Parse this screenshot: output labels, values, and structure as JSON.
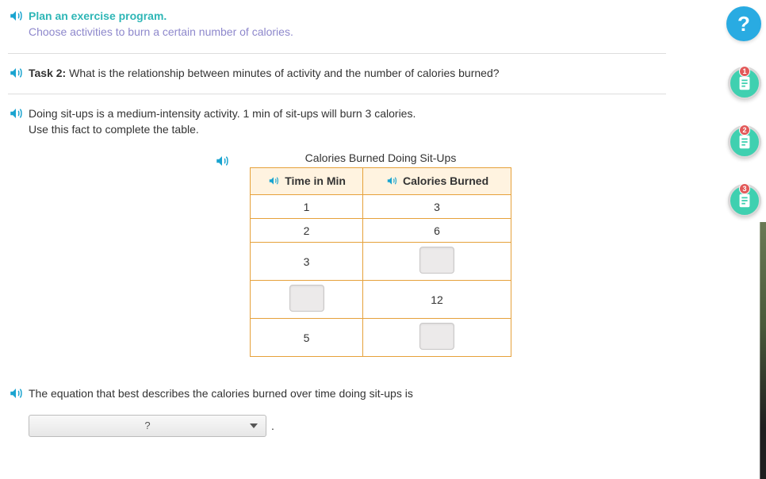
{
  "intro": {
    "title": "Plan an exercise program.",
    "subtitle": "Choose activities to burn a certain number of calories."
  },
  "task": {
    "label": "Task 2:",
    "question": "What is the relationship between minutes of activity and the number of calories burned?"
  },
  "instruction": {
    "line1": "Doing sit-ups is a medium-intensity activity. 1 min of sit-ups will burn 3 calories.",
    "line2": "Use this fact to complete the table."
  },
  "table": {
    "title": "Calories Burned Doing Sit-Ups",
    "col1": "Time in Min",
    "col2": "Calories Burned",
    "rows": [
      {
        "time": "1",
        "cal": "3",
        "time_input": false,
        "cal_input": false
      },
      {
        "time": "2",
        "cal": "6",
        "time_input": false,
        "cal_input": false
      },
      {
        "time": "3",
        "cal": "",
        "time_input": false,
        "cal_input": true
      },
      {
        "time": "",
        "cal": "12",
        "time_input": true,
        "cal_input": false
      },
      {
        "time": "5",
        "cal": "",
        "time_input": false,
        "cal_input": true
      }
    ]
  },
  "equation": {
    "prompt": "The equation that best describes the calories burned over time doing sit-ups is",
    "placeholder": "?",
    "period": "."
  },
  "sidebar": {
    "help": "?",
    "tasks": [
      "1",
      "2",
      "3"
    ]
  },
  "chart_data": {
    "type": "table",
    "title": "Calories Burned Doing Sit-Ups",
    "columns": [
      "Time in Min",
      "Calories Burned"
    ],
    "rows": [
      [
        1,
        3
      ],
      [
        2,
        6
      ],
      [
        3,
        null
      ],
      [
        null,
        12
      ],
      [
        5,
        null
      ]
    ],
    "note": "null = blank input cell to be filled by student"
  }
}
